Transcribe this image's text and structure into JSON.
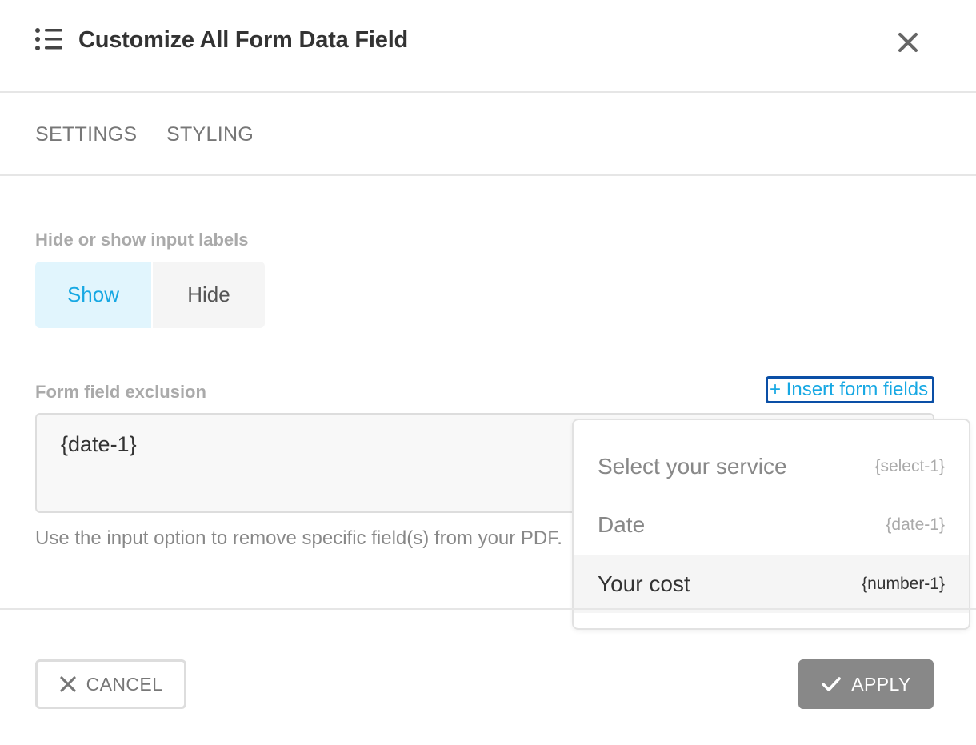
{
  "header": {
    "title": "Customize All Form Data Field",
    "list_icon": "list-icon",
    "close_icon": "close-icon"
  },
  "tabs": [
    {
      "label": "SETTINGS"
    },
    {
      "label": "STYLING"
    }
  ],
  "labels_section": {
    "label": "Hide or show input labels",
    "options": [
      "Show",
      "Hide"
    ],
    "selected": "Show"
  },
  "exclusion_section": {
    "label": "Form field exclusion",
    "insert_link": "+ Insert form fields",
    "value": "{date-1}",
    "help_text": "Use the input option to remove specific field(s) from your PDF."
  },
  "dropdown": {
    "items": [
      {
        "label": "Select your service",
        "tag": "{select-1}"
      },
      {
        "label": "Date",
        "tag": "{date-1}"
      },
      {
        "label": "Your cost",
        "tag": "{number-1}"
      }
    ],
    "highlighted": "Your cost"
  },
  "footer": {
    "cancel_label": "CANCEL",
    "cancel_icon": "x-icon",
    "apply_label": "APPLY",
    "apply_icon": "check-icon"
  },
  "colors": {
    "accent": "#17a8e3",
    "show_bg": "#e1f5fd",
    "focus_ring": "#0a4fa6",
    "apply_bg": "#888888"
  }
}
